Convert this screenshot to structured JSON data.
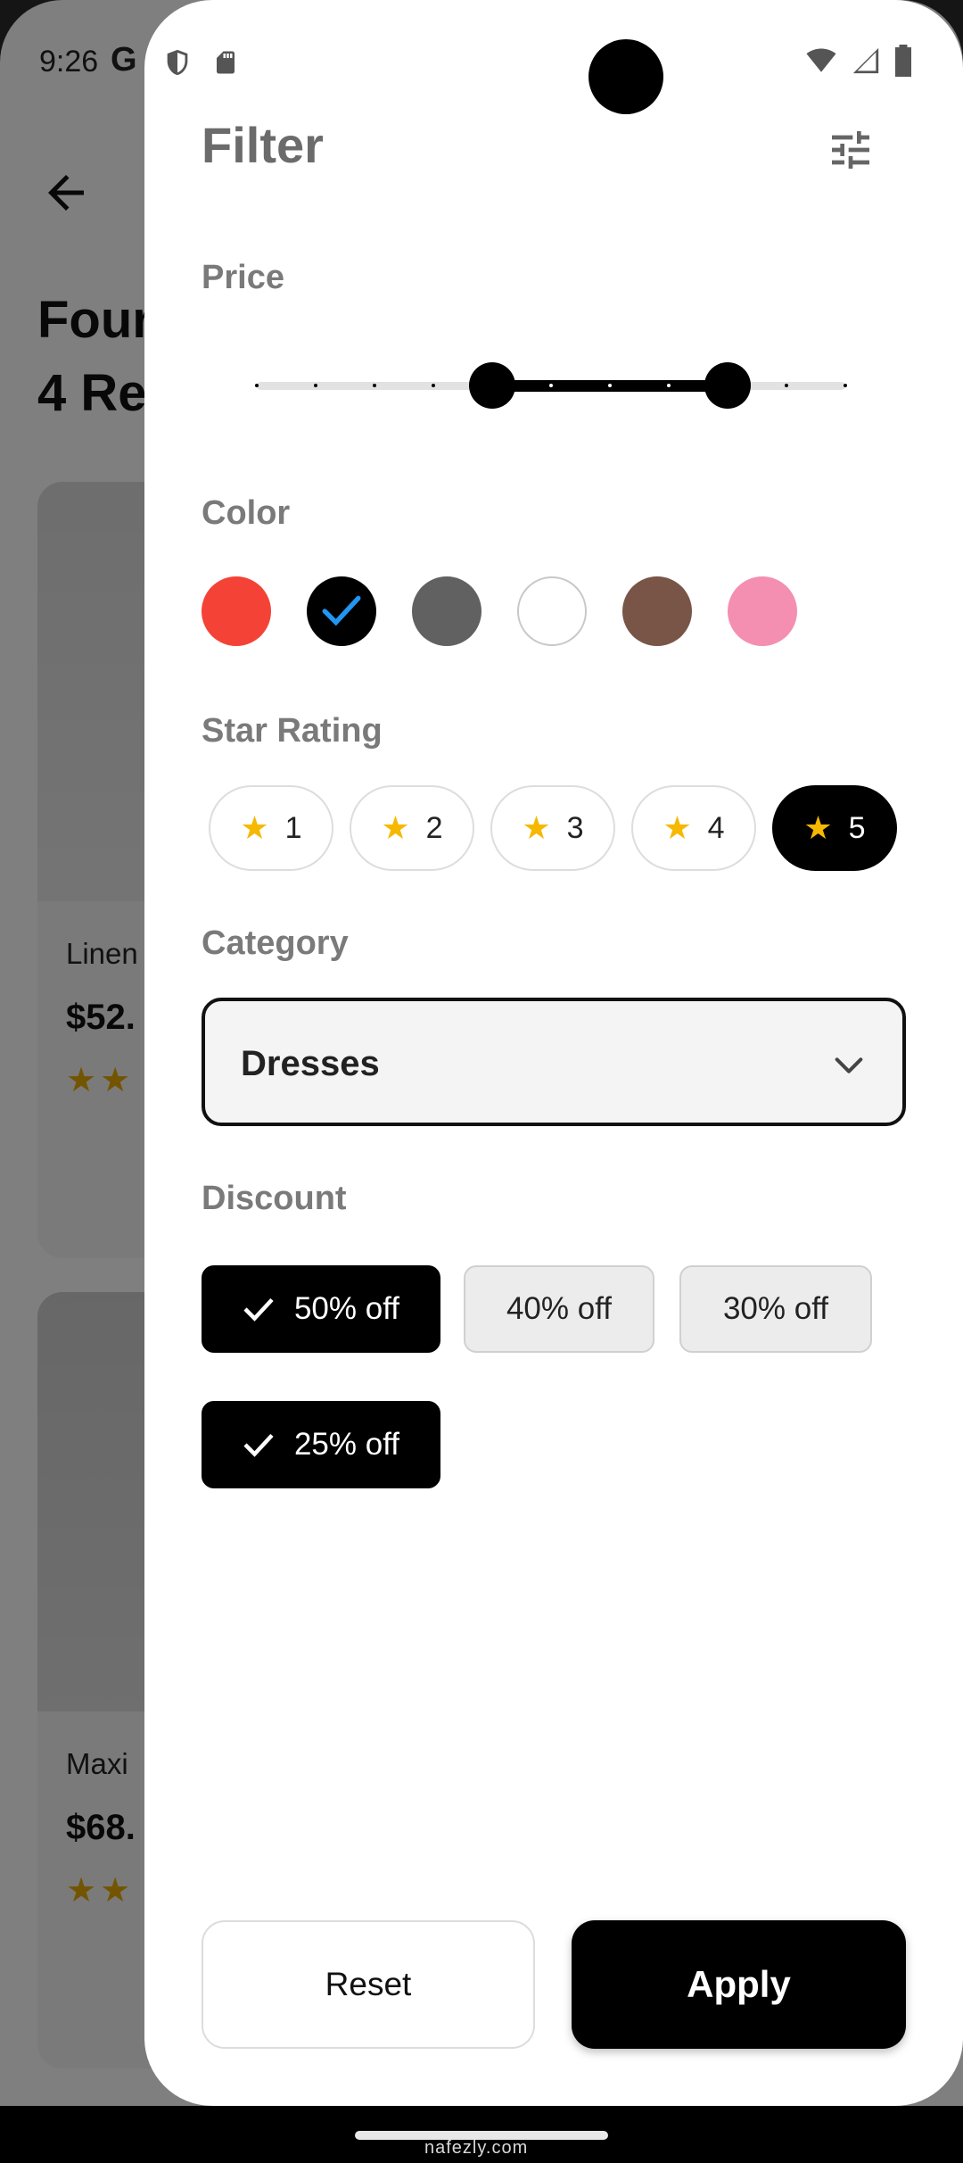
{
  "status_bar": {
    "time": "9:26",
    "google_glyph": "G"
  },
  "background_page": {
    "found_line1": "Four",
    "found_line2": "4 Re",
    "cards": [
      {
        "name": "Linen",
        "price": "$52.",
        "stars": "★★"
      },
      {
        "name": "Maxi",
        "price": "$68.",
        "stars": "★★"
      }
    ]
  },
  "filter": {
    "title": "Filter",
    "price_label": "Price",
    "price_range": {
      "low_fraction": 0.4,
      "high_fraction": 0.8,
      "tick_count": 11
    },
    "color_label": "Color",
    "colors": [
      {
        "name": "red",
        "hex": "#f44336",
        "selected": false
      },
      {
        "name": "black",
        "hex": "#000000",
        "selected": true
      },
      {
        "name": "gray",
        "hex": "#616161",
        "selected": false
      },
      {
        "name": "white",
        "hex": "#ffffff",
        "selected": false
      },
      {
        "name": "brown",
        "hex": "#795548",
        "selected": false
      },
      {
        "name": "pink",
        "hex": "#f48fb1",
        "selected": false
      }
    ],
    "check_color": "#2196f3",
    "star_label": "Star Rating",
    "star_options": [
      "1",
      "2",
      "3",
      "4",
      "5"
    ],
    "star_selected": "5",
    "category_label": "Category",
    "category_value": "Dresses",
    "discount_label": "Discount",
    "discounts": [
      {
        "label": "50% off",
        "selected": true
      },
      {
        "label": "40% off",
        "selected": false
      },
      {
        "label": "30% off",
        "selected": false
      },
      {
        "label": "25% off",
        "selected": true
      }
    ],
    "reset_label": "Reset",
    "apply_label": "Apply"
  },
  "watermark": "nafezly.com"
}
